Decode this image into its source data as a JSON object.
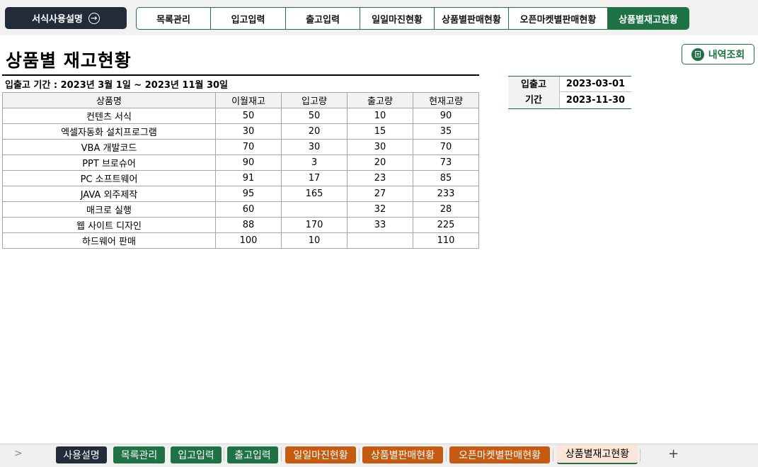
{
  "guide_button": {
    "label": "서식사용설명",
    "icon": "arrow-right-circle-icon"
  },
  "nav_tabs": [
    "목록관리",
    "입고입력",
    "출고입력",
    "일일마진현황",
    "상품별판매현황",
    "오픈마켓별판매현황",
    "상품별재고현황"
  ],
  "active_nav_tab": "상품별재고현황",
  "page_title": "상품별 재고현황",
  "view_button": {
    "label": "내역조회",
    "icon": "list-icon"
  },
  "period_text": "입출고 기간 : 2023년 3월 1일 ~ 2023년 11월 30일",
  "period_box": {
    "label_line1": "입출고",
    "label_line2": "기간",
    "start": "2023-03-01",
    "end": "2023-11-30"
  },
  "table": {
    "headers": [
      "상품명",
      "이월재고",
      "입고량",
      "출고량",
      "현재고량"
    ],
    "rows": [
      [
        "컨텐츠 서식",
        "50",
        "50",
        "10",
        "90"
      ],
      [
        "엑셀자동화 설치프로그램",
        "30",
        "20",
        "15",
        "35"
      ],
      [
        "VBA 개발코드",
        "70",
        "30",
        "30",
        "70"
      ],
      [
        "PPT 브로슈어",
        "90",
        "3",
        "20",
        "73"
      ],
      [
        "PC 소프트웨어",
        "91",
        "17",
        "23",
        "85"
      ],
      [
        "JAVA 외주제작",
        "95",
        "165",
        "27",
        "233"
      ],
      [
        "매크로 실행",
        "60",
        "",
        "32",
        "28"
      ],
      [
        "웹 사이트 디자인",
        "88",
        "170",
        "33",
        "225"
      ],
      [
        "하드웨어 판매",
        "100",
        "10",
        "",
        "110"
      ]
    ]
  },
  "sheet_tabs": [
    "사용설명",
    "목록관리",
    "입고입력",
    "출고입력",
    "일일마진현황",
    "상품별판매현황",
    "오픈마켓별판매현황",
    "상품별재고현황"
  ],
  "sheet_nav_symbol": ">",
  "add_sheet_symbol": "+",
  "colors": {
    "navy": "#222b3a",
    "green": "#1f7244",
    "orange": "#c55a11",
    "active_sheet": "#fbe5d6"
  }
}
